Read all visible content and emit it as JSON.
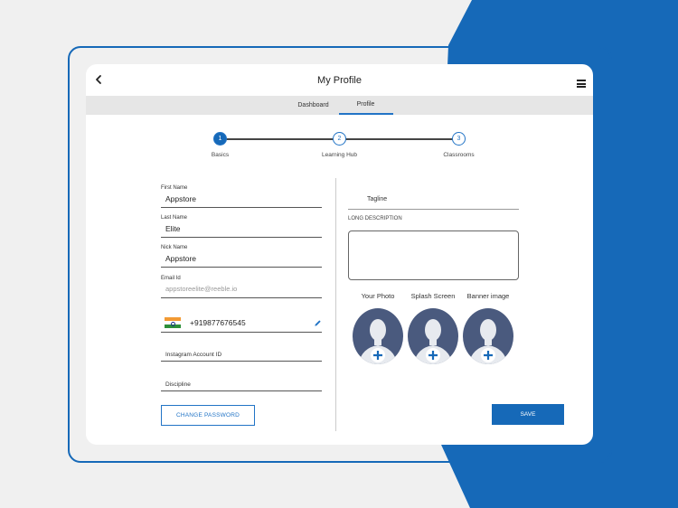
{
  "colors": {
    "brand_blue": "#1669b8",
    "accent_blue": "#2274c6",
    "avatar_slate": "#4a5a7e"
  },
  "header": {
    "title": "My Profile",
    "back_icon": "chevron-left-icon",
    "menu_icon": "hamburger-menu-icon"
  },
  "tabs": [
    {
      "label": "Dashboard",
      "active": false
    },
    {
      "label": "Profile",
      "active": true
    }
  ],
  "stepper": {
    "current": 1,
    "steps": [
      {
        "number": "1",
        "label": "Basics"
      },
      {
        "number": "2",
        "label": "Learning Hub"
      },
      {
        "number": "3",
        "label": "Classrooms"
      }
    ]
  },
  "form": {
    "first_name": {
      "label": "First Name",
      "value": "Appstore"
    },
    "last_name": {
      "label": "Last Name",
      "value": "Elite"
    },
    "nick_name": {
      "label": "Nick Name",
      "value": "Appstore"
    },
    "email": {
      "label": "Email Id",
      "value": "appstoreelite@reeble.io"
    },
    "phone": {
      "value": "+919877676545",
      "flag_icon": "india-flag-icon",
      "edit_icon": "pencil-icon"
    },
    "instagram": {
      "placeholder": "Instagram Account ID"
    },
    "discipline": {
      "placeholder": "Discipline"
    },
    "tagline": {
      "placeholder": "Tagline"
    },
    "long_description": {
      "label": "LONG DESCRIPTION",
      "value": ""
    }
  },
  "photos": [
    {
      "label": "Your Photo",
      "icon": "avatar-add-icon"
    },
    {
      "label": "Splash Screen",
      "icon": "avatar-add-icon"
    },
    {
      "label": "Banner image",
      "icon": "avatar-add-icon"
    }
  ],
  "buttons": {
    "change_password": "CHANGE PASSWORD",
    "save": "SAVE"
  }
}
